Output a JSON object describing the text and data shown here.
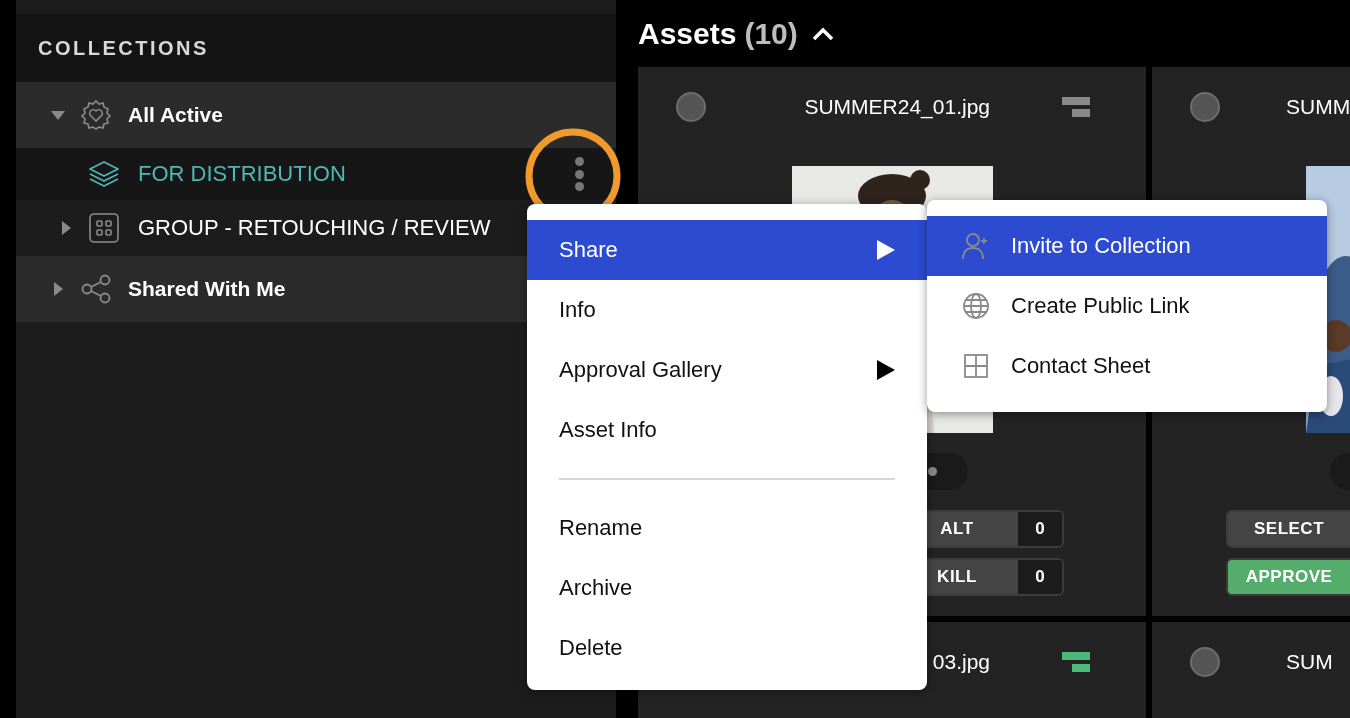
{
  "sidebar": {
    "heading": "COLLECTIONS",
    "items": [
      {
        "label": "All Active",
        "kind": "badge",
        "selected": false,
        "expanded": true,
        "children": [
          {
            "label": "FOR DISTRIBUTION",
            "kind": "layers",
            "selected": true,
            "has_menu": true
          },
          {
            "label": "GROUP - RETOUCHING / REVIEW",
            "kind": "group",
            "selected": false,
            "expanded": false
          }
        ]
      },
      {
        "label": "Shared With Me",
        "kind": "share",
        "selected": false,
        "expanded": false
      }
    ]
  },
  "assets": {
    "title": "Assets",
    "count": "(10)",
    "expanded": true,
    "cards": [
      {
        "title": "SUMMER24_01.jpg",
        "selected": false,
        "status_icon": {
          "color": "#8a8a8a"
        },
        "image": {
          "kind": "picture"
        },
        "actions": [
          {
            "label": "ALT",
            "count": "0",
            "kind": "alt"
          },
          {
            "label": "KILL",
            "count": "0",
            "kind": "kill"
          }
        ]
      },
      {
        "title": "SUMM",
        "selected": false,
        "image": {
          "kind": "picture"
        },
        "actions": [
          {
            "label": "SELECT",
            "kind": "select"
          },
          {
            "label": "APPROVE",
            "kind": "approve"
          }
        ]
      },
      {
        "title": "03.jpg",
        "status_icon": {
          "color": "#4cb87a"
        }
      },
      {
        "title": "SUM",
        "selected": false
      }
    ]
  },
  "context_menu": {
    "items": [
      {
        "kind": "item",
        "label": "Share",
        "selected": true,
        "has_submenu": true
      },
      {
        "kind": "item",
        "label": "Info",
        "selected": false,
        "has_submenu": false
      },
      {
        "kind": "item",
        "label": "Approval Gallery",
        "selected": false,
        "has_submenu": true
      },
      {
        "kind": "item",
        "label": "Asset Info",
        "selected": false,
        "has_submenu": false
      },
      {
        "kind": "divider"
      },
      {
        "kind": "item",
        "label": "Rename",
        "selected": false,
        "has_submenu": false
      },
      {
        "kind": "item",
        "label": "Archive",
        "selected": false,
        "has_submenu": false
      },
      {
        "kind": "item",
        "label": "Delete",
        "selected": false,
        "has_submenu": false
      }
    ]
  },
  "submenu": {
    "items": [
      {
        "kind": "invite",
        "label": "Invite to Collection",
        "selected": true
      },
      {
        "kind": "globe",
        "label": "Create Public Link",
        "selected": false
      },
      {
        "kind": "sheet",
        "label": "Contact Sheet",
        "selected": false
      }
    ]
  }
}
